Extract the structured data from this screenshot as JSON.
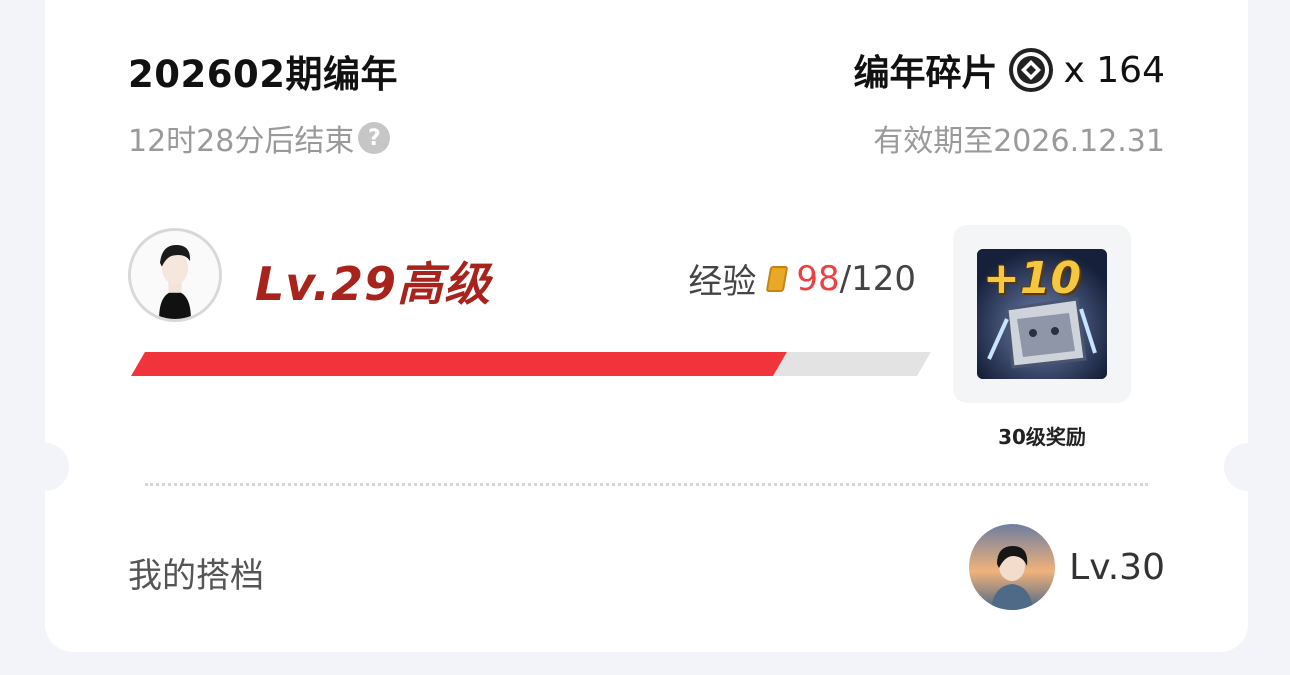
{
  "header": {
    "title": "202602期编年",
    "countdown": "12时28分后结束",
    "fragments_label": "编年碎片",
    "fragments_count": "x 164",
    "validity": "有效期至2026.12.31"
  },
  "level": {
    "text": "Lv.29高级",
    "exp_label": "经验",
    "exp_current": "98",
    "exp_total": "/120",
    "progress_fraction": 0.8167
  },
  "reward": {
    "badge_text": "+10",
    "label": "30级奖励"
  },
  "partner": {
    "label": "我的搭档",
    "level": "Lv.30"
  },
  "icons": {
    "help": "question-mark-icon",
    "fragment": "diamond-coin-icon",
    "exp": "exp-coin-icon"
  },
  "colors": {
    "level_text": "#a8231c",
    "progress_fill": "#f1333c",
    "exp_current": "#ee4040"
  }
}
